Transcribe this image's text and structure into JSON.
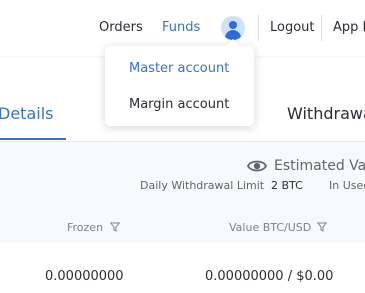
{
  "nav": {
    "orders": "Orders",
    "funds": "Funds",
    "logout": "Logout",
    "app_download": "App D"
  },
  "dropdown": {
    "items": [
      {
        "label": "Master account",
        "active": true
      },
      {
        "label": "Margin account",
        "active": false
      }
    ]
  },
  "tabs": {
    "details": "Details",
    "withdrawals": "Withdrawa"
  },
  "info": {
    "estimated_label": "Estimated Valu",
    "daily_limit_label": "Daily Withdrawal Limit",
    "daily_limit_value": "2 BTC",
    "in_use_label": "In Used"
  },
  "table": {
    "columns": {
      "frozen": "Frozen",
      "value": "Value BTC/USD"
    },
    "rows": [
      {
        "frozen": "0.00000000",
        "value": "0.00000000 / $0.00"
      }
    ]
  },
  "colors": {
    "accent": "#3a72c8",
    "text": "#2b2f36",
    "muted": "#7b838c",
    "background": "#f8f9fb"
  },
  "icons": {
    "avatar": "user-avatar-icon",
    "visibility": "eye-icon",
    "filter": "filter-icon"
  }
}
